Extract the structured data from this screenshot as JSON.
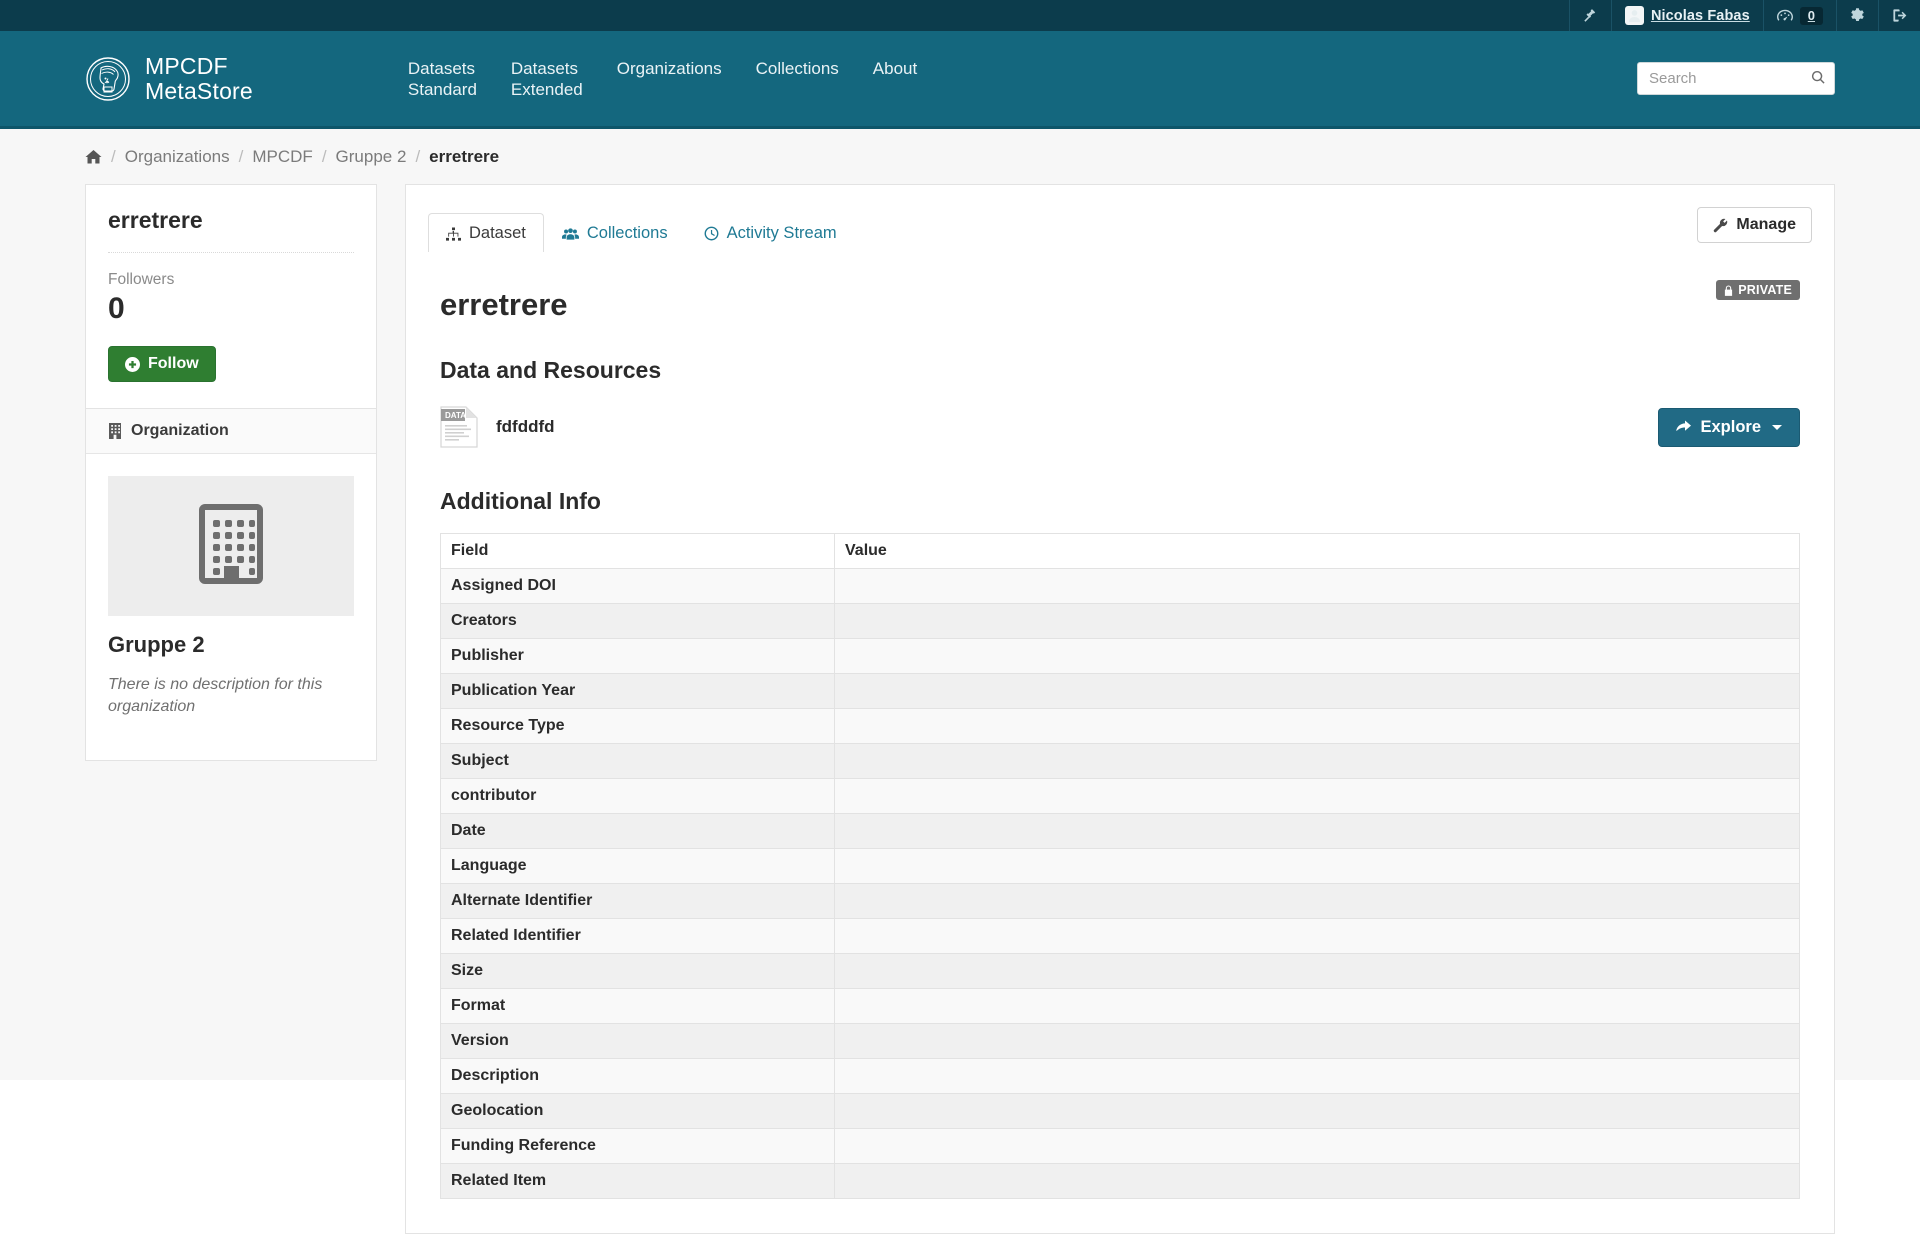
{
  "account_bar": {
    "hammer_icon": "gavel-icon",
    "user_name": "Nicolas Fabas",
    "dashboard_icon": "dashboard-icon",
    "notification_count": "0",
    "gear_icon": "gear-icon",
    "logout_icon": "logout-icon"
  },
  "header": {
    "logo_line1": "MPCDF",
    "logo_line2": "MetaStore",
    "logo_icon": "mpg-minerva-logo-icon",
    "nav": [
      {
        "label": "Datasets\nStandard"
      },
      {
        "label": "Datasets\nExtended"
      },
      {
        "label": "Organizations"
      },
      {
        "label": "Collections"
      },
      {
        "label": "About"
      }
    ],
    "search": {
      "placeholder": "Search",
      "value": "",
      "icon": "search-icon"
    }
  },
  "breadcrumb": {
    "home_icon": "home-icon",
    "items": [
      {
        "label": "Organizations"
      },
      {
        "label": "MPCDF"
      },
      {
        "label": "Gruppe 2"
      },
      {
        "label": "erretrere"
      }
    ],
    "separator": "/"
  },
  "sidebar": {
    "dataset_title": "erretrere",
    "followers_label": "Followers",
    "followers_count": "0",
    "follow_button": "Follow",
    "follow_icon": "plus-circle-icon",
    "organization_module": {
      "heading": "Organization",
      "heading_icon": "building-icon",
      "placeholder_icon": "building-placeholder-icon",
      "name": "Gruppe 2",
      "description": "There is no description for this organization"
    }
  },
  "main": {
    "tabs": [
      {
        "label": "Dataset",
        "icon": "sitemap-icon",
        "active": true
      },
      {
        "label": "Collections",
        "icon": "users-icon",
        "active": false
      },
      {
        "label": "Activity Stream",
        "icon": "clock-icon",
        "active": false
      }
    ],
    "manage_button": "Manage",
    "manage_icon": "wrench-icon",
    "dataset_title": "erretrere",
    "visibility_badge": "PRIVATE",
    "visibility_icon": "lock-icon",
    "data_resources_heading": "Data and Resources",
    "resources": [
      {
        "name": "fdfddfd",
        "icon": "data-file-icon",
        "type_label": "DATA"
      }
    ],
    "explore_button": "Explore",
    "explore_icon": "share-arrow-icon",
    "additional_info_heading": "Additional Info",
    "table": {
      "columns": [
        "Field",
        "Value"
      ],
      "rows": [
        {
          "field": "Assigned DOI",
          "value": ""
        },
        {
          "field": "Creators",
          "value": ""
        },
        {
          "field": "Publisher",
          "value": ""
        },
        {
          "field": "Publication Year",
          "value": ""
        },
        {
          "field": "Resource Type",
          "value": ""
        },
        {
          "field": "Subject",
          "value": ""
        },
        {
          "field": "contributor",
          "value": ""
        },
        {
          "field": "Date",
          "value": ""
        },
        {
          "field": "Language",
          "value": ""
        },
        {
          "field": "Alternate Identifier",
          "value": ""
        },
        {
          "field": "Related Identifier",
          "value": ""
        },
        {
          "field": "Size",
          "value": ""
        },
        {
          "field": "Format",
          "value": ""
        },
        {
          "field": "Version",
          "value": ""
        },
        {
          "field": "Description",
          "value": ""
        },
        {
          "field": "Geolocation",
          "value": ""
        },
        {
          "field": "Funding Reference",
          "value": ""
        },
        {
          "field": "Related Item",
          "value": ""
        }
      ]
    }
  },
  "colors": {
    "topbar": "#0c3c4c",
    "header": "#14677e",
    "link": "#1f7a94",
    "follow_green": "#2f7e31",
    "explore_teal": "#216a85",
    "badge_gray": "#6f6f6f"
  }
}
